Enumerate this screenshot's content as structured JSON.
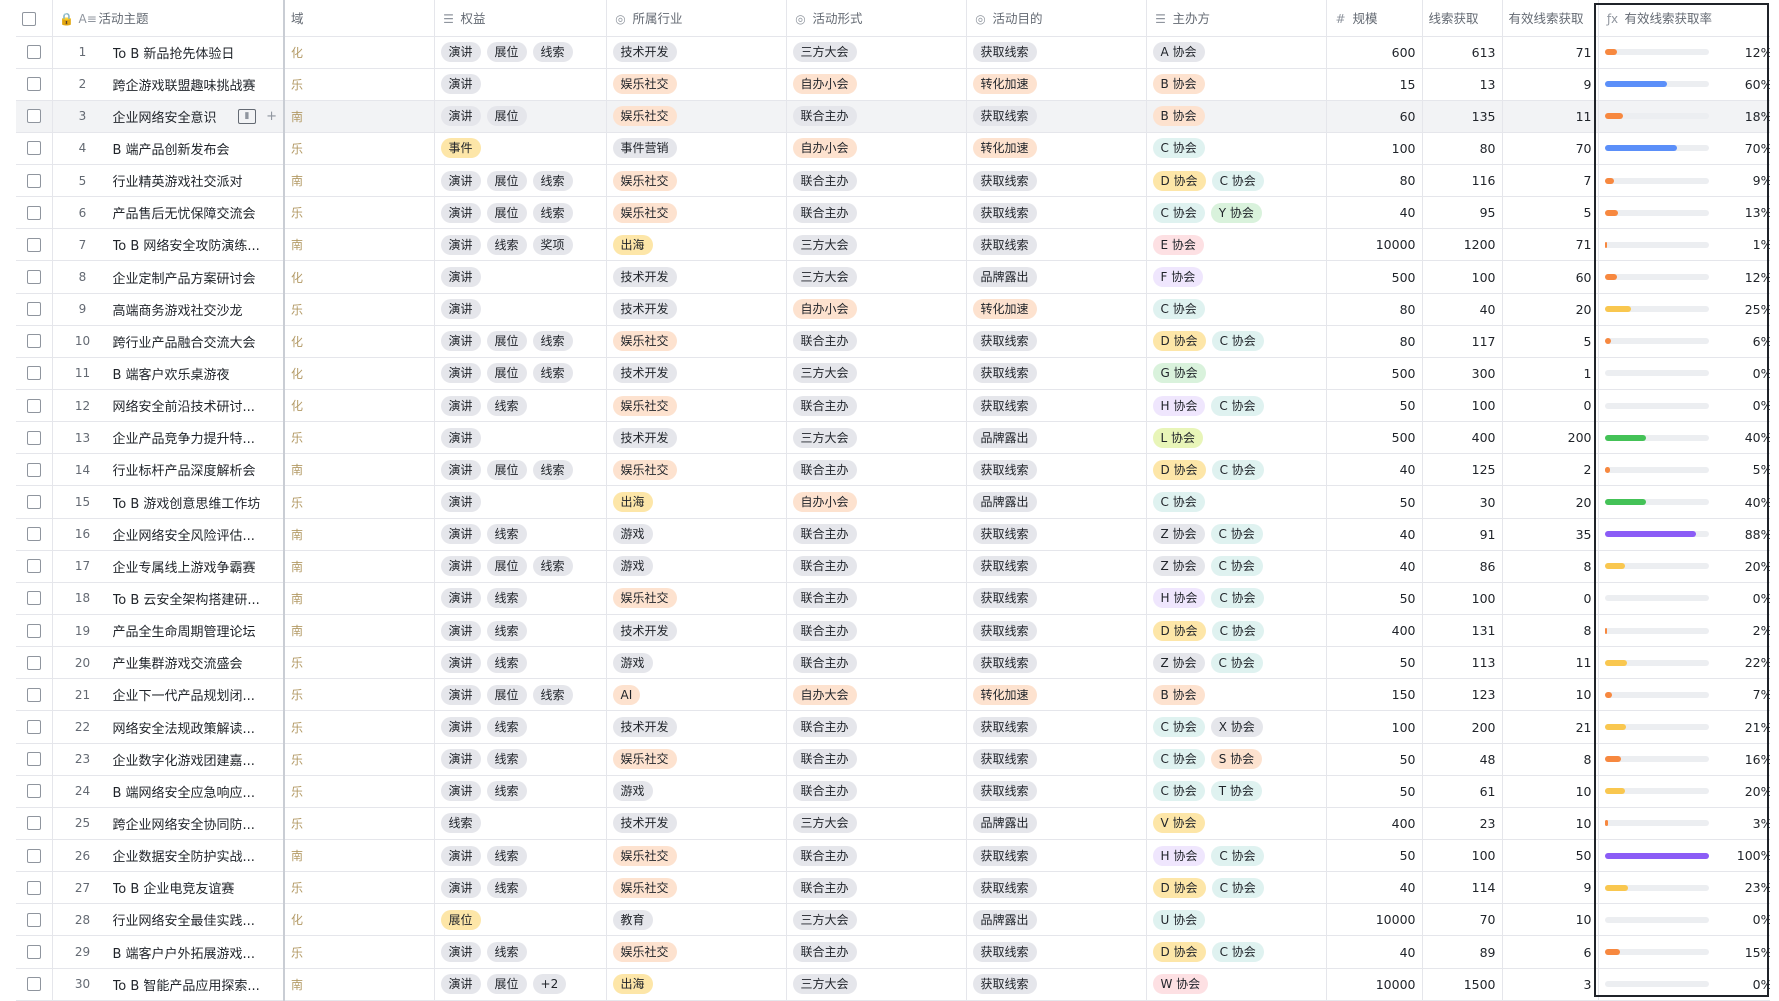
{
  "headers": {
    "topic": "活动主题",
    "domain": "域",
    "benefit": "权益",
    "industry": "所属行业",
    "form": "活动形式",
    "goal": "活动目的",
    "host": "主办方",
    "scale": "规模",
    "leads": "线索获取",
    "valid": "有效线索获取",
    "rate": "有效线索获取率"
  },
  "icons": {
    "lock": "lock-icon",
    "text": "text-field-icon",
    "multi": "multi-select-icon",
    "single": "single-select-icon",
    "number": "number-icon",
    "formula": "formula-icon"
  },
  "colors": {
    "orange": "#f7883f",
    "blue": "#5b8ff9",
    "yellow": "#f9c74f",
    "green": "#44c257",
    "purple": "#8b5cf6"
  },
  "rows": [
    {
      "idx": "1",
      "topic": "To B 新品抢先体验日",
      "domain": "化",
      "benefits": [
        "演讲",
        "展位",
        "线索"
      ],
      "industry": "技术开发",
      "ind_cls": "tech",
      "form": "三方大会",
      "form_cls": "",
      "goal": "获取线索",
      "goal_cls": "",
      "hosts": [
        [
          "A 协会",
          "a"
        ]
      ],
      "scale": "600",
      "leads": "613",
      "valid": "71",
      "rate": 0.12,
      "rate_label": "12%",
      "bar": "orange"
    },
    {
      "idx": "2",
      "topic": "跨企游戏联盟趣味挑战赛",
      "domain": "乐",
      "benefits": [
        "演讲"
      ],
      "industry": "娱乐社交",
      "ind_cls": "ent",
      "form": "自办小会",
      "form_cls": "small",
      "goal": "转化加速",
      "goal_cls": "conv",
      "hosts": [
        [
          "B 协会",
          "b"
        ]
      ],
      "scale": "15",
      "leads": "13",
      "valid": "9",
      "rate": 0.6,
      "rate_label": "60%",
      "bar": "blue"
    },
    {
      "idx": "3",
      "topic": "企业网络安全意识",
      "domain": "南",
      "benefits": [
        "演讲",
        "展位"
      ],
      "industry": "娱乐社交",
      "ind_cls": "ent",
      "form": "联合主办",
      "form_cls": "",
      "goal": "获取线索",
      "goal_cls": "",
      "hosts": [
        [
          "B 协会",
          "b"
        ]
      ],
      "scale": "60",
      "leads": "135",
      "valid": "11",
      "rate": 0.18,
      "rate_label": "18%",
      "bar": "orange",
      "hover": true
    },
    {
      "idx": "4",
      "topic": "B 端产品创新发布会",
      "domain": "乐",
      "benefits": [
        "事件"
      ],
      "industry": "事件营销",
      "ind_cls": "evt",
      "form": "自办小会",
      "form_cls": "small",
      "goal": "转化加速",
      "goal_cls": "conv",
      "hosts": [
        [
          "C 协会",
          "c"
        ]
      ],
      "scale": "100",
      "leads": "80",
      "valid": "70",
      "rate": 0.7,
      "rate_label": "70%",
      "bar": "blue",
      "benefit_orange": true
    },
    {
      "idx": "5",
      "topic": "行业精英游戏社交派对",
      "domain": "南",
      "benefits": [
        "演讲",
        "展位",
        "线索"
      ],
      "industry": "娱乐社交",
      "ind_cls": "ent",
      "form": "联合主办",
      "form_cls": "",
      "goal": "获取线索",
      "goal_cls": "",
      "hosts": [
        [
          "D 协会",
          "d"
        ],
        [
          "C 协会",
          "c"
        ]
      ],
      "scale": "80",
      "leads": "116",
      "valid": "7",
      "rate": 0.09,
      "rate_label": "9%",
      "bar": "orange"
    },
    {
      "idx": "6",
      "topic": "产品售后无忧保障交流会",
      "domain": "乐",
      "benefits": [
        "演讲",
        "展位",
        "线索"
      ],
      "industry": "娱乐社交",
      "ind_cls": "ent",
      "form": "联合主办",
      "form_cls": "",
      "goal": "获取线索",
      "goal_cls": "",
      "hosts": [
        [
          "C 协会",
          "c"
        ],
        [
          "Y 协会",
          "y"
        ]
      ],
      "scale": "40",
      "leads": "95",
      "valid": "5",
      "rate": 0.13,
      "rate_label": "13%",
      "bar": "orange"
    },
    {
      "idx": "7",
      "topic": "To B 网络安全攻防演练...",
      "domain": "南",
      "benefits": [
        "演讲",
        "线索",
        "奖项"
      ],
      "industry": "出海",
      "ind_cls": "sea",
      "form": "三方大会",
      "form_cls": "",
      "goal": "获取线索",
      "goal_cls": "",
      "hosts": [
        [
          "E 协会",
          "e"
        ]
      ],
      "scale": "10000",
      "leads": "1200",
      "valid": "71",
      "rate": 0.01,
      "rate_label": "1%",
      "bar": "orange"
    },
    {
      "idx": "8",
      "topic": "企业定制产品方案研讨会",
      "domain": "化",
      "benefits": [
        "演讲"
      ],
      "industry": "技术开发",
      "ind_cls": "tech",
      "form": "三方大会",
      "form_cls": "",
      "goal": "品牌露出",
      "goal_cls": "brand",
      "hosts": [
        [
          "F 协会",
          "f"
        ]
      ],
      "scale": "500",
      "leads": "100",
      "valid": "60",
      "rate": 0.12,
      "rate_label": "12%",
      "bar": "orange"
    },
    {
      "idx": "9",
      "topic": "高端商务游戏社交沙龙",
      "domain": "乐",
      "benefits": [
        "演讲"
      ],
      "industry": "技术开发",
      "ind_cls": "tech",
      "form": "自办小会",
      "form_cls": "small",
      "goal": "转化加速",
      "goal_cls": "conv",
      "hosts": [
        [
          "C 协会",
          "c"
        ]
      ],
      "scale": "80",
      "leads": "40",
      "valid": "20",
      "rate": 0.25,
      "rate_label": "25%",
      "bar": "yellow"
    },
    {
      "idx": "10",
      "topic": "跨行业产品融合交流大会",
      "domain": "化",
      "benefits": [
        "演讲",
        "展位",
        "线索"
      ],
      "industry": "娱乐社交",
      "ind_cls": "ent",
      "form": "联合主办",
      "form_cls": "",
      "goal": "获取线索",
      "goal_cls": "",
      "hosts": [
        [
          "D 协会",
          "d"
        ],
        [
          "C 协会",
          "c"
        ]
      ],
      "scale": "80",
      "leads": "117",
      "valid": "5",
      "rate": 0.06,
      "rate_label": "6%",
      "bar": "orange"
    },
    {
      "idx": "11",
      "topic": "B 端客户欢乐桌游夜",
      "domain": "化",
      "benefits": [
        "演讲",
        "展位",
        "线索"
      ],
      "industry": "技术开发",
      "ind_cls": "tech",
      "form": "三方大会",
      "form_cls": "",
      "goal": "获取线索",
      "goal_cls": "",
      "hosts": [
        [
          "G 协会",
          "g"
        ]
      ],
      "scale": "500",
      "leads": "300",
      "valid": "1",
      "rate": 0.0,
      "rate_label": "0%",
      "bar": "orange"
    },
    {
      "idx": "12",
      "topic": "网络安全前沿技术研讨...",
      "domain": "化",
      "benefits": [
        "演讲",
        "线索"
      ],
      "industry": "娱乐社交",
      "ind_cls": "ent",
      "form": "联合主办",
      "form_cls": "",
      "goal": "获取线索",
      "goal_cls": "",
      "hosts": [
        [
          "H 协会",
          "h"
        ],
        [
          "C 协会",
          "c"
        ]
      ],
      "scale": "50",
      "leads": "100",
      "valid": "0",
      "rate": 0.0,
      "rate_label": "0%",
      "bar": "orange"
    },
    {
      "idx": "13",
      "topic": "企业产品竞争力提升特...",
      "domain": "乐",
      "benefits": [
        "演讲"
      ],
      "industry": "技术开发",
      "ind_cls": "tech",
      "form": "三方大会",
      "form_cls": "",
      "goal": "品牌露出",
      "goal_cls": "brand",
      "hosts": [
        [
          "L 协会",
          "l"
        ]
      ],
      "scale": "500",
      "leads": "400",
      "valid": "200",
      "rate": 0.4,
      "rate_label": "40%",
      "bar": "green"
    },
    {
      "idx": "14",
      "topic": "行业标杆产品深度解析会",
      "domain": "南",
      "benefits": [
        "演讲",
        "展位",
        "线索"
      ],
      "industry": "娱乐社交",
      "ind_cls": "ent",
      "form": "联合主办",
      "form_cls": "",
      "goal": "获取线索",
      "goal_cls": "",
      "hosts": [
        [
          "D 协会",
          "d"
        ],
        [
          "C 协会",
          "c"
        ]
      ],
      "scale": "40",
      "leads": "125",
      "valid": "2",
      "rate": 0.05,
      "rate_label": "5%",
      "bar": "orange"
    },
    {
      "idx": "15",
      "topic": "To B 游戏创意思维工作坊",
      "domain": "乐",
      "benefits": [
        "演讲"
      ],
      "industry": "出海",
      "ind_cls": "sea",
      "form": "自办小会",
      "form_cls": "small",
      "goal": "品牌露出",
      "goal_cls": "brand",
      "hosts": [
        [
          "C 协会",
          "c"
        ]
      ],
      "scale": "50",
      "leads": "30",
      "valid": "20",
      "rate": 0.4,
      "rate_label": "40%",
      "bar": "green"
    },
    {
      "idx": "16",
      "topic": "企业网络安全风险评估...",
      "domain": "南",
      "benefits": [
        "演讲",
        "线索"
      ],
      "industry": "游戏",
      "ind_cls": "game",
      "form": "联合主办",
      "form_cls": "",
      "goal": "获取线索",
      "goal_cls": "",
      "hosts": [
        [
          "Z 协会",
          "z"
        ],
        [
          "C 协会",
          "c"
        ]
      ],
      "scale": "40",
      "leads": "91",
      "valid": "35",
      "rate": 0.88,
      "rate_label": "88%",
      "bar": "purple"
    },
    {
      "idx": "17",
      "topic": "企业专属线上游戏争霸赛",
      "domain": "南",
      "benefits": [
        "演讲",
        "展位",
        "线索"
      ],
      "industry": "游戏",
      "ind_cls": "game",
      "form": "联合主办",
      "form_cls": "",
      "goal": "获取线索",
      "goal_cls": "",
      "hosts": [
        [
          "Z 协会",
          "z"
        ],
        [
          "C 协会",
          "c"
        ]
      ],
      "scale": "40",
      "leads": "86",
      "valid": "8",
      "rate": 0.2,
      "rate_label": "20%",
      "bar": "yellow"
    },
    {
      "idx": "18",
      "topic": "To B 云安全架构搭建研...",
      "domain": "南",
      "benefits": [
        "演讲",
        "线索"
      ],
      "industry": "娱乐社交",
      "ind_cls": "ent",
      "form": "联合主办",
      "form_cls": "",
      "goal": "获取线索",
      "goal_cls": "",
      "hosts": [
        [
          "H 协会",
          "h"
        ],
        [
          "C 协会",
          "c"
        ]
      ],
      "scale": "50",
      "leads": "100",
      "valid": "0",
      "rate": 0.0,
      "rate_label": "0%",
      "bar": "orange"
    },
    {
      "idx": "19",
      "topic": "产品全生命周期管理论坛",
      "domain": "南",
      "benefits": [
        "演讲",
        "线索"
      ],
      "industry": "技术开发",
      "ind_cls": "tech",
      "form": "联合主办",
      "form_cls": "",
      "goal": "获取线索",
      "goal_cls": "",
      "hosts": [
        [
          "D 协会",
          "d"
        ],
        [
          "C 协会",
          "c"
        ]
      ],
      "scale": "400",
      "leads": "131",
      "valid": "8",
      "rate": 0.02,
      "rate_label": "2%",
      "bar": "orange"
    },
    {
      "idx": "20",
      "topic": "产业集群游戏交流盛会",
      "domain": "乐",
      "benefits": [
        "演讲",
        "线索"
      ],
      "industry": "游戏",
      "ind_cls": "game",
      "form": "联合主办",
      "form_cls": "",
      "goal": "获取线索",
      "goal_cls": "",
      "hosts": [
        [
          "Z 协会",
          "z"
        ],
        [
          "C 协会",
          "c"
        ]
      ],
      "scale": "50",
      "leads": "113",
      "valid": "11",
      "rate": 0.22,
      "rate_label": "22%",
      "bar": "yellow"
    },
    {
      "idx": "21",
      "topic": "企业下一代产品规划闭...",
      "domain": "乐",
      "benefits": [
        "演讲",
        "展位",
        "线索"
      ],
      "industry": "AI",
      "ind_cls": "ai",
      "form": "自办大会",
      "form_cls": "small",
      "goal": "转化加速",
      "goal_cls": "conv",
      "hosts": [
        [
          "B 协会",
          "b"
        ]
      ],
      "scale": "150",
      "leads": "123",
      "valid": "10",
      "rate": 0.07,
      "rate_label": "7%",
      "bar": "orange"
    },
    {
      "idx": "22",
      "topic": "网络安全法规政策解读...",
      "domain": "乐",
      "benefits": [
        "演讲",
        "线索"
      ],
      "industry": "技术开发",
      "ind_cls": "tech",
      "form": "联合主办",
      "form_cls": "",
      "goal": "获取线索",
      "goal_cls": "",
      "hosts": [
        [
          "C 协会",
          "c"
        ],
        [
          "X 协会",
          "x"
        ]
      ],
      "scale": "100",
      "leads": "200",
      "valid": "21",
      "rate": 0.21,
      "rate_label": "21%",
      "bar": "yellow"
    },
    {
      "idx": "23",
      "topic": "企业数字化游戏团建嘉...",
      "domain": "乐",
      "benefits": [
        "演讲",
        "线索"
      ],
      "industry": "娱乐社交",
      "ind_cls": "ent",
      "form": "联合主办",
      "form_cls": "",
      "goal": "获取线索",
      "goal_cls": "",
      "hosts": [
        [
          "C 协会",
          "c"
        ],
        [
          "S 协会",
          "s"
        ]
      ],
      "scale": "50",
      "leads": "48",
      "valid": "8",
      "rate": 0.16,
      "rate_label": "16%",
      "bar": "orange"
    },
    {
      "idx": "24",
      "topic": "B 端网络安全应急响应...",
      "domain": "乐",
      "benefits": [
        "演讲",
        "线索"
      ],
      "industry": "游戏",
      "ind_cls": "game",
      "form": "联合主办",
      "form_cls": "",
      "goal": "获取线索",
      "goal_cls": "",
      "hosts": [
        [
          "C 协会",
          "c"
        ],
        [
          "T 协会",
          "t"
        ]
      ],
      "scale": "50",
      "leads": "61",
      "valid": "10",
      "rate": 0.2,
      "rate_label": "20%",
      "bar": "yellow"
    },
    {
      "idx": "25",
      "topic": "跨企业网络安全协同防...",
      "domain": "乐",
      "benefits": [
        "线索"
      ],
      "industry": "技术开发",
      "ind_cls": "tech",
      "form": "三方大会",
      "form_cls": "",
      "goal": "品牌露出",
      "goal_cls": "brand",
      "hosts": [
        [
          "V 协会",
          "v"
        ]
      ],
      "scale": "400",
      "leads": "23",
      "valid": "10",
      "rate": 0.03,
      "rate_label": "3%",
      "bar": "orange"
    },
    {
      "idx": "26",
      "topic": "企业数据安全防护实战...",
      "domain": "南",
      "benefits": [
        "演讲",
        "线索"
      ],
      "industry": "娱乐社交",
      "ind_cls": "ent",
      "form": "联合主办",
      "form_cls": "",
      "goal": "获取线索",
      "goal_cls": "",
      "hosts": [
        [
          "H 协会",
          "h"
        ],
        [
          "C 协会",
          "c"
        ]
      ],
      "scale": "50",
      "leads": "100",
      "valid": "50",
      "rate": 1.0,
      "rate_label": "100%",
      "bar": "purple"
    },
    {
      "idx": "27",
      "topic": "To B 企业电竞友谊赛",
      "domain": "乐",
      "benefits": [
        "演讲",
        "线索"
      ],
      "industry": "娱乐社交",
      "ind_cls": "ent",
      "form": "联合主办",
      "form_cls": "",
      "goal": "获取线索",
      "goal_cls": "",
      "hosts": [
        [
          "D 协会",
          "d"
        ],
        [
          "C 协会",
          "c"
        ]
      ],
      "scale": "40",
      "leads": "114",
      "valid": "9",
      "rate": 0.23,
      "rate_label": "23%",
      "bar": "yellow"
    },
    {
      "idx": "28",
      "topic": "行业网络安全最佳实践...",
      "domain": "化",
      "benefits": [
        "展位"
      ],
      "industry": "教育",
      "ind_cls": "edu",
      "form": "三方大会",
      "form_cls": "",
      "goal": "品牌露出",
      "goal_cls": "brand",
      "hosts": [
        [
          "U 协会",
          "u"
        ]
      ],
      "scale": "10000",
      "leads": "70",
      "valid": "10",
      "rate": 0.0,
      "rate_label": "0%",
      "bar": "orange",
      "benefit_orange": true
    },
    {
      "idx": "29",
      "topic": "B 端客户户外拓展游戏...",
      "domain": "乐",
      "benefits": [
        "演讲",
        "线索"
      ],
      "industry": "娱乐社交",
      "ind_cls": "ent",
      "form": "联合主办",
      "form_cls": "",
      "goal": "获取线索",
      "goal_cls": "",
      "hosts": [
        [
          "D 协会",
          "d"
        ],
        [
          "C 协会",
          "c"
        ]
      ],
      "scale": "40",
      "leads": "89",
      "valid": "6",
      "rate": 0.15,
      "rate_label": "15%",
      "bar": "orange"
    },
    {
      "idx": "30",
      "topic": "To B 智能产品应用探索...",
      "domain": "南",
      "benefits": [
        "演讲",
        "展位",
        "+2"
      ],
      "industry": "出海",
      "ind_cls": "sea",
      "form": "三方大会",
      "form_cls": "",
      "goal": "获取线索",
      "goal_cls": "",
      "hosts": [
        [
          "W 协会",
          "w"
        ]
      ],
      "scale": "10000",
      "leads": "1500",
      "valid": "3",
      "rate": 0.0,
      "rate_label": "0%",
      "bar": "orange"
    }
  ]
}
